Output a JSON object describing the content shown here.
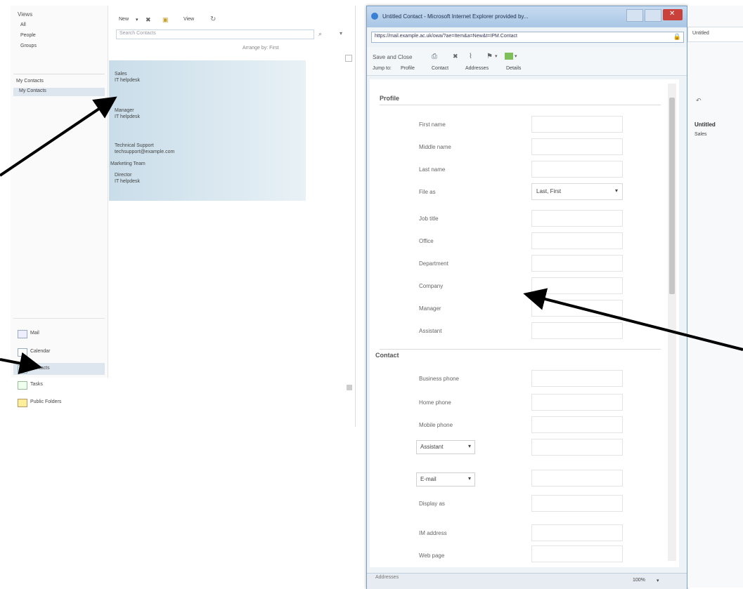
{
  "owa": {
    "nav_header": "Views",
    "nav_items": [
      "All",
      "People",
      "Groups"
    ],
    "folders_header": "My Contacts",
    "folders": [
      "My Contacts"
    ],
    "bottom_nav": [
      "Mail",
      "Calendar",
      "Contacts",
      "Tasks",
      "Public Folders"
    ],
    "toolbar": {
      "new_label": "New",
      "delete_icon": "x-icon",
      "move_icon": "folder-icon",
      "view_label": "View",
      "refresh_icon": "refresh-icon"
    },
    "search_placeholder": "Search Contacts",
    "arrange": "Arrange by: First",
    "contacts": [
      {
        "name": "Sales",
        "detail": "IT helpdesk"
      },
      {
        "name": "Manager",
        "detail": "IT helpdesk"
      },
      {
        "name": "Technical Support",
        "detail": "techsupport@example.com"
      },
      {
        "name": "Marketing Team",
        "detail": ""
      },
      {
        "name": "Director",
        "detail": "IT helpdesk"
      }
    ]
  },
  "ie": {
    "title": "Untitled Contact - Microsoft Internet Explorer provided by...",
    "address": "https://mail.example.ac.uk/owa/?ae=Item&a=New&t=IPM.Contact",
    "toolbar": {
      "save_close": "Save and Close",
      "print_icon": "print-icon",
      "delete_icon": "x-icon",
      "attach_icon": "paperclip-icon",
      "flag_icon": "flag-icon",
      "categories_icon": "category-icon"
    },
    "jump_to": "Jump to:",
    "tabs": [
      "Profile",
      "Contact",
      "Addresses",
      "Details"
    ],
    "sections": {
      "profile": "Profile",
      "contact": "Contact",
      "addresses": "Addresses"
    },
    "profile_fields": [
      "First name",
      "Middle name",
      "Last name",
      "File as",
      "Job title",
      "Office",
      "Department",
      "Company",
      "Manager",
      "Assistant"
    ],
    "file_as_value": "Last, First",
    "contact_fields": [
      "Business phone",
      "Home phone",
      "Mobile phone"
    ],
    "assistant_select": "Assistant",
    "email_select": "E-mail",
    "display_as": "Display as",
    "im_address": "IM address",
    "web_page": "Web page",
    "zoom": "100%"
  },
  "reading": {
    "tab_label": "Untitled",
    "sub_label": "Sales"
  },
  "colors": {
    "selection": "#c9dde9",
    "ie_frame": "#7aa0c8",
    "close": "#c9413a"
  }
}
